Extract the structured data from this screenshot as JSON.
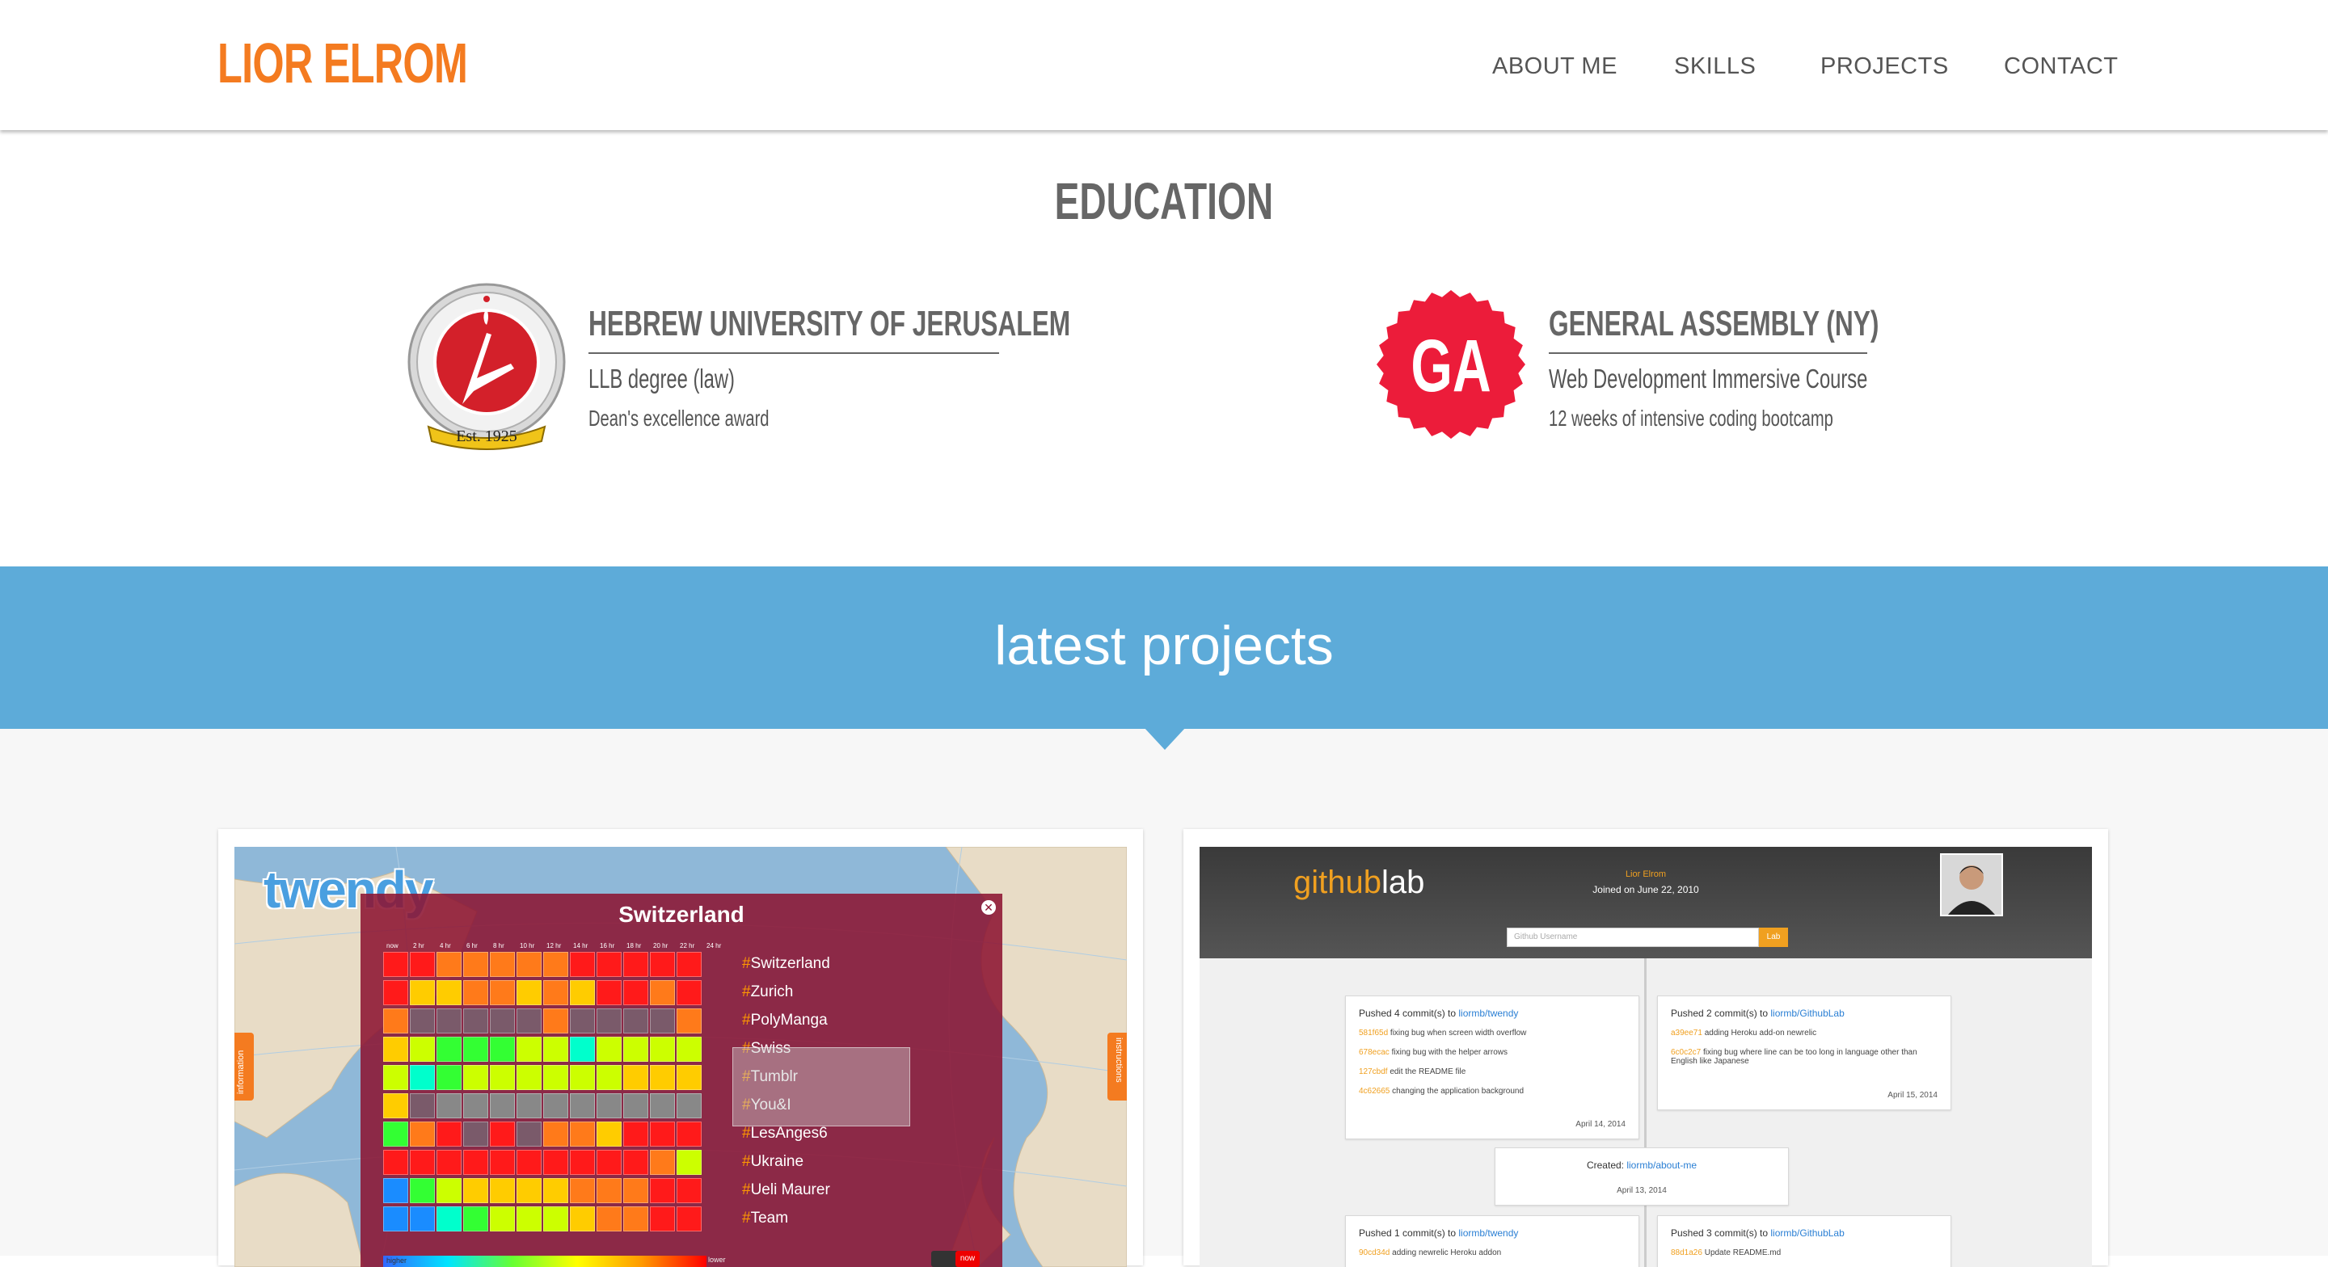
{
  "header": {
    "logo": "LIOR ELROM",
    "nav": [
      "ABOUT ME",
      "SKILLS",
      "PROJECTS",
      "CONTACT"
    ]
  },
  "education": {
    "title": "EDUCATION",
    "schools": [
      {
        "name": "HEBREW UNIVERSITY OF JERUSALEM",
        "degree": "LLB degree (law)",
        "detail": "Dean's excellence award",
        "seal_text": "Est. 1925"
      },
      {
        "name": "GENERAL ASSEMBLY (NY)",
        "degree": "Web Development Immersive Course",
        "detail": "12 weeks of intensive coding bootcamp",
        "logo_text": "GA"
      }
    ]
  },
  "projects": {
    "title": "latest projects",
    "twendy": {
      "logo": "twendy",
      "panel_title": "Switzerland",
      "time_labels": [
        "now",
        "2 hr",
        "4 hr",
        "6 hr",
        "8 hr",
        "10 hr",
        "12 hr",
        "14 hr",
        "16 hr",
        "18 hr",
        "20 hr",
        "22 hr",
        "24 hr"
      ],
      "trends": [
        "#Switzerland",
        "#Zurich",
        "#PolyManga",
        "#Swiss",
        "#Tumblr",
        "#You&I",
        "#LesAnges6",
        "#Ukraine",
        "#Ueli Maurer",
        "#Team"
      ],
      "left_tab": "information",
      "right_tab": "instructions",
      "scale_left": "higher",
      "scale_right": "lower",
      "now_btn": "now"
    },
    "githublab": {
      "logo_a": "github",
      "logo_b": "lab",
      "user_name": "Lior Elrom",
      "joined": "Joined on June 22, 2010",
      "search_placeholder": "Github Username",
      "search_btn": "Lab",
      "events": [
        {
          "title": "Pushed 4 commit(s) to",
          "repo": "liormb/twendy",
          "commits": [
            [
              "581f65d",
              "fixing bug when screen width overflow"
            ],
            [
              "678ecac",
              "fixing bug with the helper arrows"
            ],
            [
              "127cbdf",
              "edit the README file"
            ],
            [
              "4c62665",
              "changing the application background"
            ]
          ],
          "date": "April 14, 2014"
        },
        {
          "title": "Pushed 2 commit(s) to",
          "repo": "liormb/GithubLab",
          "commits": [
            [
              "a39ee71",
              "adding Heroku add-on newrelic"
            ],
            [
              "6c0c2c7",
              "fixing bug where line can be too long in language other than English like Japanese"
            ]
          ],
          "date": "April 15, 2014"
        },
        {
          "title": "Created:",
          "repo": "liormb/about-me",
          "commits": [],
          "date": "April 13, 2014"
        },
        {
          "title": "Pushed 1 commit(s) to",
          "repo": "liormb/twendy",
          "commits": [
            [
              "90cd34d",
              "adding newrelic Heroku addon"
            ]
          ],
          "date": ""
        },
        {
          "title": "Pushed 3 commit(s) to",
          "repo": "liormb/GithubLab",
          "commits": [
            [
              "88d1a26",
              "Update README.md"
            ]
          ],
          "date": ""
        }
      ]
    }
  }
}
